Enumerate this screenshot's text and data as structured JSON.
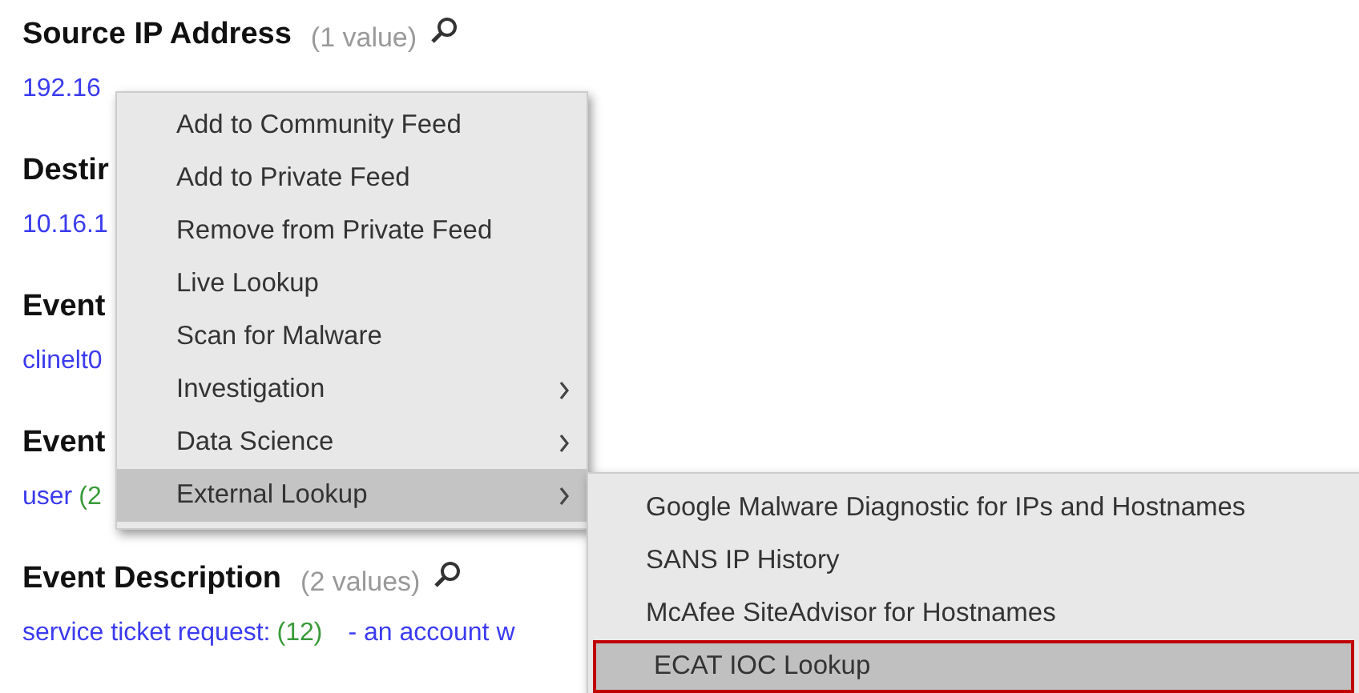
{
  "sections": [
    {
      "heading": "Source IP Address",
      "count": "(1 value)",
      "search": true,
      "values": [
        {
          "text": "192.16"
        }
      ]
    },
    {
      "heading": "Destir",
      "values": [
        {
          "text": "10.16.1"
        }
      ]
    },
    {
      "heading": "Event",
      "values": [
        {
          "text": "clinelt0"
        }
      ]
    },
    {
      "heading": "Event",
      "values": [
        {
          "text": "user",
          "count": "(2"
        }
      ]
    },
    {
      "heading": "Event Description",
      "count": "(2 values)",
      "search": true,
      "values": [
        {
          "text": "service ticket request:",
          "count": "(12)"
        },
        {
          "text": "- an account w"
        }
      ]
    }
  ],
  "context_menu": {
    "items": [
      {
        "label": "Add to Community Feed",
        "submenu": false,
        "selected": false
      },
      {
        "label": "Add to Private Feed",
        "submenu": false,
        "selected": false
      },
      {
        "label": "Remove from Private Feed",
        "submenu": false,
        "selected": false
      },
      {
        "label": "Live Lookup",
        "submenu": false,
        "selected": false
      },
      {
        "label": "Scan for Malware",
        "submenu": false,
        "selected": false
      },
      {
        "label": "Investigation",
        "submenu": true,
        "selected": false
      },
      {
        "label": "Data Science",
        "submenu": true,
        "selected": false
      },
      {
        "label": "External Lookup",
        "submenu": true,
        "selected": true
      }
    ]
  },
  "submenu": {
    "items": [
      {
        "label": "Google Malware Diagnostic for IPs and Hostnames",
        "selected": false
      },
      {
        "label": "SANS IP History",
        "selected": false
      },
      {
        "label": "McAfee SiteAdvisor for Hostnames",
        "selected": false
      },
      {
        "label": "ECAT IOC Lookup",
        "selected": true
      }
    ]
  }
}
